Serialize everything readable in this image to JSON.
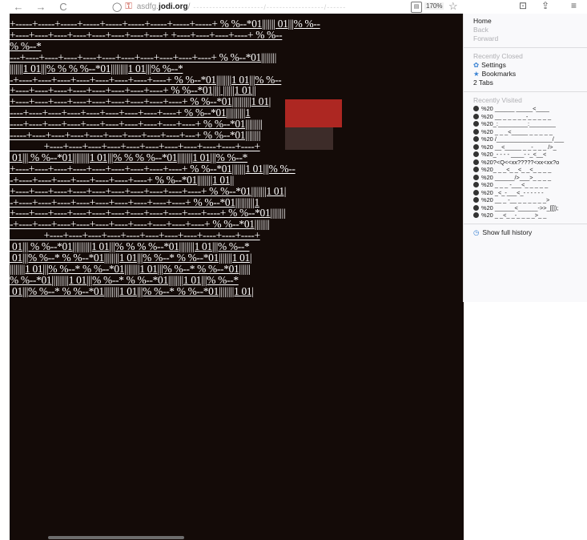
{
  "toolbar": {
    "back_icon": "←",
    "forward_icon": "→",
    "reload_icon": "C",
    "url_prefix": "asdfg.",
    "url_domain": "jodi.org",
    "url_slash": "/",
    "url_tail": "----------------------/------------------/------",
    "zoom": "170%",
    "bookmark_star": "☆",
    "pocket": "⊡",
    "extensions": "⇪",
    "menu": "≡"
  },
  "menu": {
    "nav": [
      {
        "label": "Home",
        "enabled": true
      },
      {
        "label": "Back",
        "enabled": false
      },
      {
        "label": "Forward",
        "enabled": false
      }
    ],
    "recently_closed_header": "Recently Closed",
    "recently_closed": [
      {
        "label": "Settings",
        "icon": "gear-icon"
      },
      {
        "label": "Bookmarks",
        "icon": "star-icon"
      },
      {
        "label": "2 Tabs",
        "icon": ""
      }
    ],
    "recently_visited_header": "Recently Visited",
    "recently_visited": [
      "%20 ______ _____<____",
      "%20 __ _ _ _ _ _-_ _ _ _ _",
      "%20_:_________:________",
      "%20 _ _ _<_____ _ _ _ _ _",
      "%20 /_________________/___",
      "%20 __<_____ _ _-_ _ _ />_",
      "%20_- - - - ____- -_<__<",
      "%20?<Q<<xx?????<xx<xx?o",
      "%20_ _ _<_ _<_ _<_ _ _ _",
      "%20 ______/>___>_ _ _ _",
      "%20 _ _ _ -___<_ _ _ _ _",
      "%20 _<_-___<_- - - - - -",
      "%20 __ _ -__ _ _ _ _ _ _>",
      "%20 ______<______->>_[[]);",
      "%20 _ _<_ _-_ _ _ _>_ _"
    ],
    "show_full_history": "Show full history"
  },
  "art_lines": [
    "+-----+-----+-----+-----+-----+-----+-----+-----+-----+ % %--*01||||||| 01|||% %--",
    "+----+----+----+----+----+----+----+----+ +----+----+----+----+ % %--",
    "% %--*",
    "---+----+----+----+----+----+----+----+----+----+----+ % %--*01||||||||",
    "|||||||1 01|||% % % %--*01|||||||||1 01|||% %--*",
    "-+----+----+----+----+----+----+----+----+ % %--*01||||||||1 01|||% %--",
    "+----+----+----+----+----+----+----+----+ % %--*01|||| ||||||1 01||",
    "+----+----+----+----+----+----+----+----+----+ % %--*01||||||||||1 01|",
    "----+----+----+----+----+----+----+----+----+ % %--*01||||||||||1",
    "----+----+----+----+----+----+----+----+----+----+ % %--*01|||||||||",
    "-----+----+----+----+----+----+----+----+----+---+ % %--*01||||||||",
    "              +----+----+----+----+----+----+----+----+----+----+----+",
    " 01||| % %--*01|||||||||1 01|||% % % %--*01||||||||1 01|||% %--*",
    "+----+----+----+----+----+----+----+----+----+ % %--*01|||||||1 01|||% %--",
    "-+----+----+----+----+----+----+----+ % %--*01||||||||1 01||",
    "+----+----+----+----+----+----+----+----+----+----+ % %--*01||||||||1 01|",
    "-+----+----+----+----+----+----+----+----+----+ % %--*01||||||||||1",
    "+----+----+----+----+----+----+----+----+----+----+----+ % %--*01||||||||",
    "-+----+----+----+----+----+----+----+----+----+----+ % %--*01||||||||",
    "              +----+----+----+----+----+----+----+----+----+----+----+",
    " 01||| % %--*01||||||||||1 01|||% % % %--*01||||||||1 01|||% %--*",
    " 01|||% %--* % %--*01||||||||1 01|||% %--* % %--*01|||||||1 01|",
    "||||||||1 01|||% %--* % %--*01||||||||1 01|||% %--* % %--*01||||||",
    "% %--*01|||||||||1 01|||% %--* % %--*01||||||||1 01|||% %--*",
    " 01|||% %--* % %--*01||||||||1 01|||% %--* % %--*01||||||||1 01|"
  ]
}
